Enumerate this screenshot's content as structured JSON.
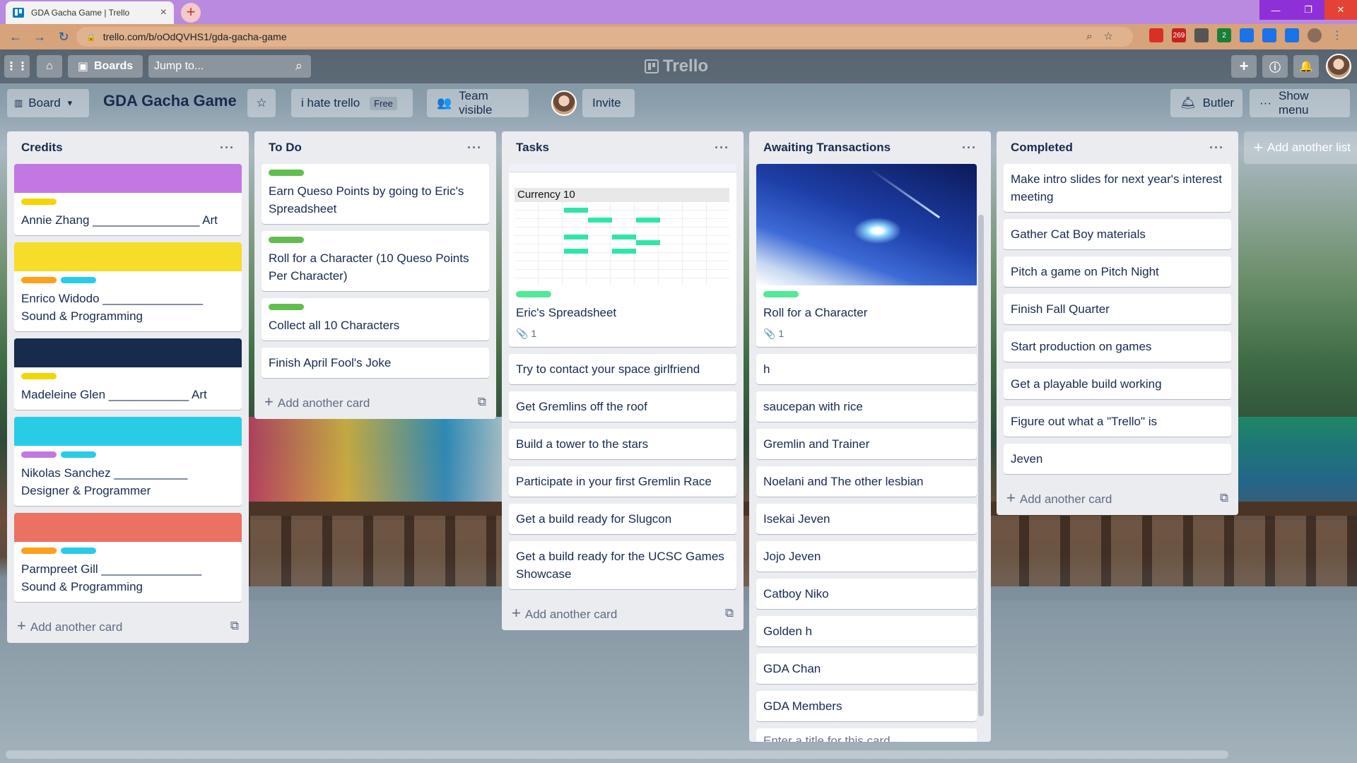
{
  "browser": {
    "tab_title": "GDA Gacha Game | Trello",
    "url": "trello.com/b/oOdQVHS1/gda-gacha-game"
  },
  "header": {
    "boards_label": "Boards",
    "jump_placeholder": "Jump to...",
    "logo_text": "Trello"
  },
  "board": {
    "view_label": "Board",
    "title": "GDA Gacha Game",
    "team_name": "i hate trello",
    "team_badge": "Free",
    "visibility": "Team visible",
    "invite": "Invite",
    "butler": "Butler",
    "show_menu": "Show menu",
    "add_list": "Add another list"
  },
  "lists": {
    "credits": {
      "title": "Credits",
      "add": "Add another card",
      "cards": [
        {
          "cover": "#c377e0",
          "labels": [
            "#f2d600"
          ],
          "text": "Annie Zhang ________________ Art"
        },
        {
          "cover": "#f5dd29",
          "labels": [
            "#ff9f1a",
            "#29cce5"
          ],
          "text": "Enrico Widodo _______________ Sound & Programming"
        },
        {
          "cover": "#172b4d",
          "labels": [
            "#f2d600"
          ],
          "text": "Madeleine Glen ____________ Art"
        },
        {
          "cover": "#29cce5",
          "labels": [
            "#c377e0",
            "#29cce5"
          ],
          "text": "Nikolas Sanchez ___________ Designer & Programmer"
        },
        {
          "cover": "#eb7161",
          "labels": [
            "#ff9f1a",
            "#29cce5"
          ],
          "text": "Parmpreet Gill _______________ Sound & Programming"
        }
      ]
    },
    "todo": {
      "title": "To Do",
      "add": "Add another card",
      "cards": [
        {
          "label": "#61bd4f",
          "text": "Earn Queso Points by going to Eric's Spreadsheet"
        },
        {
          "label": "#61bd4f",
          "text": "Roll for a Character (10 Queso Points Per Character)"
        },
        {
          "label": "#61bd4f",
          "text": "Collect all 10 Characters"
        },
        {
          "text": "Finish April Fool's Joke"
        }
      ]
    },
    "tasks": {
      "title": "Tasks",
      "add": "Add another card",
      "sheet_cell": "Currency    10",
      "first_card": {
        "label": "#51e898",
        "text": "Eric's Spreadsheet",
        "attachments": "1"
      },
      "cards": [
        "Try to contact your space girlfriend",
        "Get Gremlins off the roof",
        "Build a tower to the stars",
        "Participate in your first Gremlin Race",
        "Get a build ready for Slugcon",
        "Get a build ready for the UCSC Games Showcase"
      ]
    },
    "awaiting": {
      "title": "Awaiting Transactions",
      "first_card": {
        "label": "#51e898",
        "text": "Roll for a Character",
        "attachments": "1"
      },
      "cards": [
        "h",
        "saucepan with rice",
        "Gremlin and Trainer",
        "Noelani and The other lesbian",
        "Isekai Jeven",
        "Jojo Jeven",
        "Catboy Niko",
        "Golden h",
        "GDA Chan",
        "GDA Members"
      ],
      "enter_placeholder": "Enter a title for this card..."
    },
    "completed": {
      "title": "Completed",
      "add": "Add another card",
      "cards": [
        "Make intro slides for next year's interest meeting",
        "Gather Cat Boy materials",
        "Pitch a game on Pitch Night",
        "Finish Fall Quarter",
        "Start production on games",
        "Get a playable build working",
        "Figure out what a \"Trello\" is",
        "Jeven"
      ]
    }
  }
}
